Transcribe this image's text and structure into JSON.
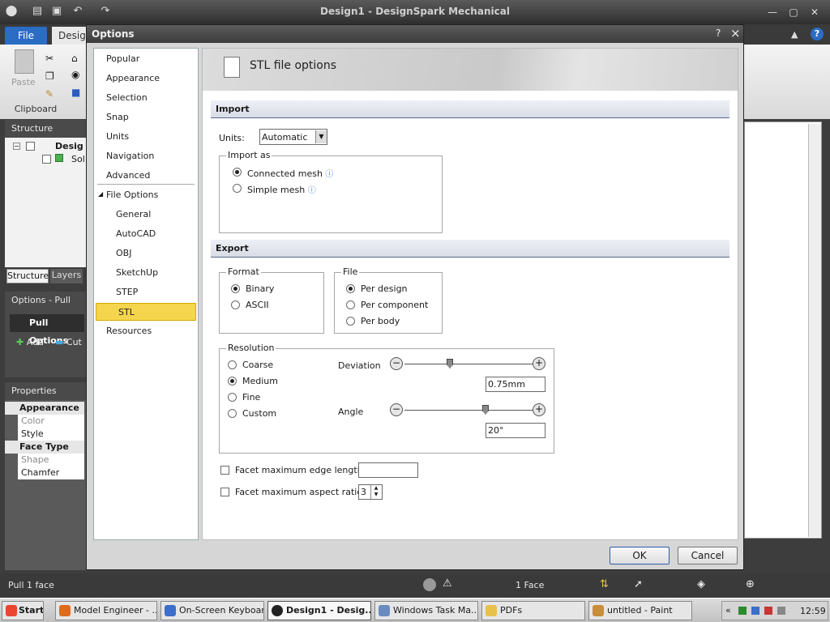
{
  "app": {
    "title": "Design1 - DesignSpark Mechanical",
    "file_tab": "File",
    "design_tab": "Desig"
  },
  "ribbon": {
    "paste": "Paste",
    "clipboard": "Clipboard"
  },
  "structure": {
    "header": "Structure",
    "item_design": "Desig",
    "item_solid": "Sol",
    "tab_structure": "Structure",
    "tab_layers": "Layers"
  },
  "options_pull": {
    "header": "Options - Pull",
    "pull_options": "Pull Options",
    "add": "Add",
    "cut": "Cut"
  },
  "properties": {
    "header": "Properties",
    "group_appearance": "Appearance",
    "color": "Color",
    "style": "Style",
    "group_face_type": "Face Type",
    "shape": "Shape",
    "chamfer": "Chamfer"
  },
  "dialog": {
    "title": "Options",
    "help": "?",
    "close": "×",
    "nav": {
      "popular": "Popular",
      "appearance": "Appearance",
      "selection": "Selection",
      "snap": "Snap",
      "units": "Units",
      "navigation": "Navigation",
      "advanced": "Advanced",
      "file_options": "File Options",
      "general": "General",
      "autocad": "AutoCAD",
      "obj": "OBJ",
      "sketchup": "SketchUp",
      "step": "STEP",
      "stl": "STL",
      "resources": "Resources"
    },
    "header": "STL file options",
    "import": {
      "title": "Import",
      "units_label": "Units:",
      "units_value": "Automatic",
      "import_as": "Import as",
      "connected_mesh": "Connected mesh",
      "simple_mesh": "Simple mesh"
    },
    "export": {
      "title": "Export",
      "format": "Format",
      "binary": "Binary",
      "ascii": "ASCII",
      "file": "File",
      "per_design": "Per design",
      "per_component": "Per component",
      "per_body": "Per body",
      "resolution": "Resolution",
      "coarse": "Coarse",
      "medium": "Medium",
      "fine": "Fine",
      "custom": "Custom",
      "deviation_label": "Deviation",
      "deviation_value": "0.75mm",
      "angle_label": "Angle",
      "angle_value": "20°",
      "facet_edge": "Facet maximum edge length:",
      "facet_aspect": "Facet maximum aspect ratio:",
      "aspect_value": "3"
    },
    "ok": "OK",
    "cancel": "Cancel"
  },
  "statusbar": {
    "left": "Pull 1 face",
    "selection": "1 Face"
  },
  "taskbar": {
    "start": "Start",
    "tasks": [
      "Model Engineer - ...",
      "On-Screen Keyboard",
      "Design1 - Desig...",
      "Windows Task Ma...",
      "PDFs",
      "untitled - Paint"
    ],
    "clock": "12:59"
  }
}
